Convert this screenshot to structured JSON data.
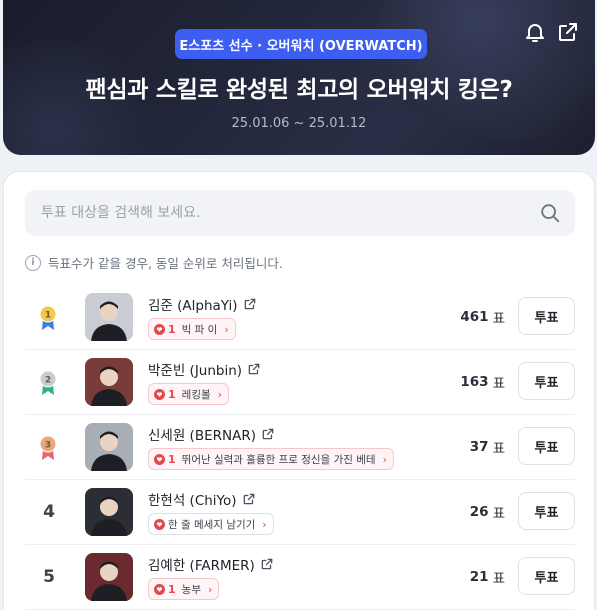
{
  "hero": {
    "chip": "E스포츠 선수 · 오버워치 (OVERWATCH)",
    "title": "팬심과 스킬로 완성된 최고의 오버워치 킹은?",
    "date": "25.01.06 ~ 25.01.12",
    "icons": [
      "bell-icon",
      "share-icon"
    ]
  },
  "search": {
    "placeholder": "투표 대상을 검색해 보세요."
  },
  "notice": "득표수가 같을 경우, 동일 순위로 처리됩니다.",
  "vote_label": "투표",
  "vote_unit": "표",
  "colors": {
    "accent": "#3d5ef0",
    "heart": "#e5484d",
    "gold": "#f2c94c",
    "silver": "#c8ccd4",
    "bronze": "#e8a87c"
  },
  "players": [
    {
      "rank": "1",
      "medal": "gold",
      "name": "김준 (AlphaYi)",
      "msg_count": "1",
      "msg": "빅 파 이",
      "votes": "461"
    },
    {
      "rank": "2",
      "medal": "silver",
      "name": "박준빈 (Junbin)",
      "msg_count": "1",
      "msg": "레킹볼",
      "votes": "163"
    },
    {
      "rank": "3",
      "medal": "bronze",
      "name": "신세원 (BERNAR)",
      "msg_count": "1",
      "msg": "뛰어난 실력과 훌륭한 프로 정신을 가진 베테",
      "votes": "37"
    },
    {
      "rank": "4",
      "medal": "",
      "name": "한현석 (ChiYo)",
      "msg_count": "",
      "msg": "한 줄 메세지 남기기",
      "votes": "26"
    },
    {
      "rank": "5",
      "medal": "",
      "name": "김예한 (FARMER)",
      "msg_count": "1",
      "msg": "농부",
      "votes": "21"
    }
  ]
}
